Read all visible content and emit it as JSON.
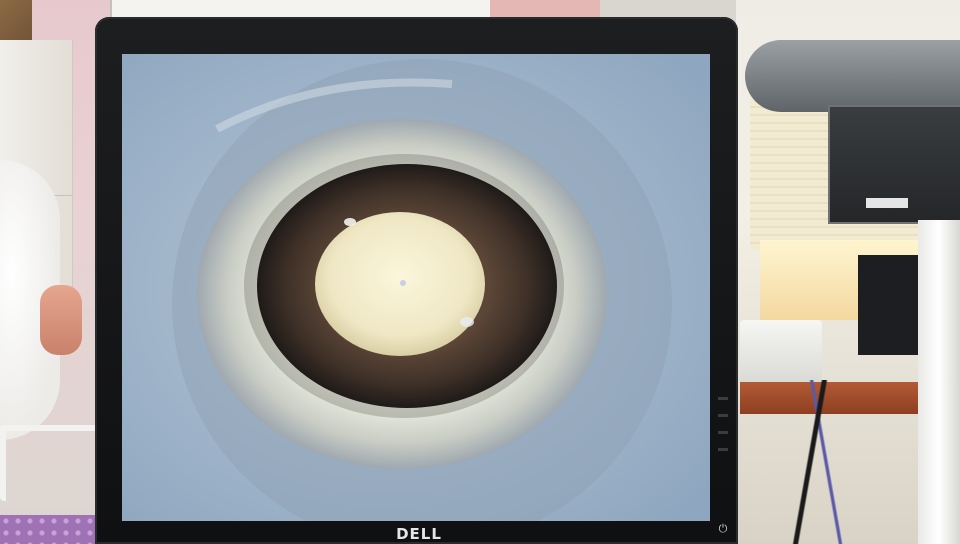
{
  "monitor": {
    "brand_label": "DELL",
    "power_icon": "power-icon"
  },
  "colors": {
    "bezel": "#141517",
    "fundus_background": "#9ab0c6",
    "iris": "#4a3a31",
    "pupil_reflex": "#f0ead0",
    "sclera_ring": "#dfe1d5"
  }
}
